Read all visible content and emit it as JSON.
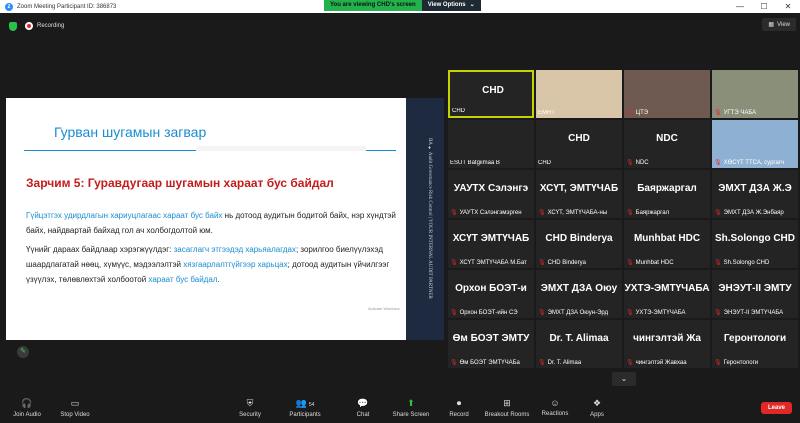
{
  "window": {
    "title": "Zoom Meeting Participant ID: 386873",
    "viewing_banner": "You are viewing CHD's screen",
    "view_options_label": "View Options"
  },
  "topbar": {
    "recording_label": "Recording",
    "view_button_label": "View"
  },
  "slide": {
    "title": "Гурван шугамын загвар",
    "subtitle": "Зарчим 5: Гуравдугаар шугамын хараат бус байдал",
    "para1_hl": "Гүйцэтгэх удирдлагын хариуцлагаас хараат бус байх",
    "para1_rest": " нь дотоод аудитын бодитой байх, нэр хүндтэй байх, найдвартай байхад гол ач холбогдолтой юм.",
    "para2_a": "Үүнийг дараах байдлаар хэрэгжүүлдэг: ",
    "para2_hl1": "засаглагч этгээдэд харьяалагдах",
    "para2_b": "; зорилгоо биелүүлэхэд шаардлагатай нөөц, хүмүүс, мэдээлэлтэй ",
    "para2_hl2": "хязгаарлалтгүйгээр харьцах",
    "para2_c": "; дотоод аудитын үйчилгээг үзүүлэх, төлөвлөхтэй холбоотой ",
    "para2_hl3": "хараат бус байдал",
    "para2_d": ".",
    "side_text": "IIA ♦ Audit Governance Risk Control | YOUR INTERNAL AUDIT PARTNER",
    "watermark": "Activate Windows"
  },
  "participants": [
    {
      "big": "CHD",
      "name": "CHD",
      "muted": false,
      "active": true
    },
    {
      "big": "",
      "name": "ЕМНТ",
      "muted": false
    },
    {
      "big": "",
      "name": "ЦТЭ",
      "muted": true
    },
    {
      "big": "",
      "name": "УГТЭ ЧАБА",
      "muted": true
    },
    {
      "big": "",
      "name": "ESUT Batgiimaa B",
      "muted": false
    },
    {
      "big": "CHD",
      "name": "CHD",
      "muted": false
    },
    {
      "big": "NDC",
      "name": "NDC",
      "muted": true
    },
    {
      "big": "",
      "name": "ХӨСҮТ ТТСА, сургагч",
      "muted": true
    },
    {
      "big": "УАУТХ Сэлэнгэ",
      "name": "УАУТХ Сэлэнгэмэрген",
      "muted": true
    },
    {
      "big": "ХСҮТ, ЭМТҮЧАБ",
      "name": "ХСҮТ, ЭМТҮЧАБА-ны",
      "muted": true
    },
    {
      "big": "Баяржаргал",
      "name": "Баяржаргал",
      "muted": true
    },
    {
      "big": "ЭМХТ ДЗА Ж.Э",
      "name": "ЭМХТ ДЗА Ж.Энбаяр",
      "muted": true
    },
    {
      "big": "ХСҮТ ЭМТҮЧАБ",
      "name": "ХСҮТ ЭМТҮЧАБА М.Бат",
      "muted": true
    },
    {
      "big": "CHD Binderya",
      "name": "CHD Binderya",
      "muted": true
    },
    {
      "big": "Munhbat HDC",
      "name": "Munhbat HDC",
      "muted": true
    },
    {
      "big": "Sh.Solongo CHD",
      "name": "Sh.Solongo CHD",
      "muted": true
    },
    {
      "big": "Орхон БОЭТ-и",
      "name": "Орхон БОЭТ-ийн СЭ",
      "muted": true
    },
    {
      "big": "ЭМХТ ДЗА Оюу",
      "name": "ЭМХТ ДЗА Оюун-Эрд",
      "muted": true
    },
    {
      "big": "УХТЭ-ЭМТҮЧАБА",
      "name": "УХТЭ-ЭМТҮЧАБА",
      "muted": true
    },
    {
      "big": "ЭНЭУТ-II ЭМТУ",
      "name": "ЭНЭУТ-II ЭМТҮЧАБА",
      "muted": true
    },
    {
      "big": "Өм БОЭТ ЭМТУ",
      "name": "Өм БОЭТ ЭМТҮЧАБа",
      "muted": true
    },
    {
      "big": "Dr. T. Alimaa",
      "name": "Dr. T. Alimaa",
      "muted": true
    },
    {
      "big": "чингэлтэй Жа",
      "name": "чингэлтэй Жавхаа",
      "muted": true
    },
    {
      "big": "Геронтологи",
      "name": "Геронтологи",
      "muted": true
    }
  ],
  "toolbar": {
    "join_audio": "Join Audio",
    "stop_video": "Stop Video",
    "security": "Security",
    "participants": "Participants",
    "participants_count": "54",
    "chat": "Chat",
    "share_screen": "Share Screen",
    "record": "Record",
    "breakout": "Breakout Rooms",
    "reactions": "Reactions",
    "apps": "Apps",
    "leave": "Leave"
  }
}
